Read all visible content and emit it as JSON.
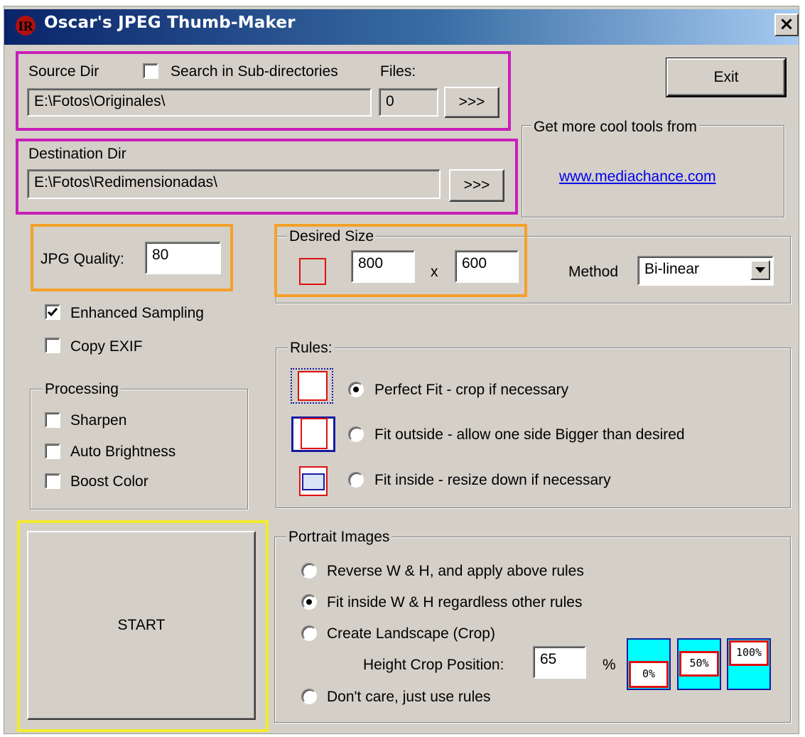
{
  "window": {
    "title": "Oscar's JPEG Thumb-Maker",
    "close_glyph": "×",
    "icon_text": "IR"
  },
  "source": {
    "label": "Source Dir",
    "search_sub_label": "Search in Sub-directories",
    "search_sub_checked": false,
    "files_label": "Files:",
    "path": "E:\\Fotos\\Originales\\",
    "files_count": "0",
    "browse_label": ">>>"
  },
  "destination": {
    "label": "Destination Dir",
    "path": "E:\\Fotos\\Redimensionadas\\",
    "browse_label": ">>>"
  },
  "exit_label": "Exit",
  "promo": {
    "legend": "Get more cool tools from",
    "link": "www.mediachance.com"
  },
  "quality": {
    "label": "JPG Quality:",
    "value": "80"
  },
  "size": {
    "legend": "Desired Size",
    "width": "800",
    "times": "x",
    "height": "600",
    "method_label": "Method",
    "method_value": "Bi-linear"
  },
  "options": {
    "enhanced_sampling": {
      "label": "Enhanced Sampling",
      "checked": true
    },
    "copy_exif": {
      "label": "Copy EXIF",
      "checked": false
    }
  },
  "processing": {
    "legend": "Processing",
    "sharpen": "Sharpen",
    "auto_brightness": "Auto Brightness",
    "boost_color": "Boost Color"
  },
  "rules": {
    "legend": "Rules:",
    "perfect_fit": "Perfect Fit - crop if necessary",
    "fit_outside": "Fit outside - allow one side Bigger than desired",
    "fit_inside": "Fit inside - resize down if necessary",
    "selected": "perfect_fit"
  },
  "start_label": "START",
  "portrait": {
    "legend": "Portrait Images",
    "reverse": "Reverse W & H, and apply above rules",
    "fit_inside": "Fit inside W & H regardless other rules",
    "landscape": "Create Landscape (Crop)",
    "crop_label": "Height Crop Position:",
    "crop_value": "65",
    "percent": "%",
    "dont_care": "Don't care, just use rules",
    "selected": "fit_inside",
    "preset_0": "0%",
    "preset_50": "50%",
    "preset_100": "100%"
  },
  "colors": {
    "highlight_magenta": "#c81fb8",
    "highlight_orange": "#f5a02a",
    "highlight_yellow": "#f2eb2c",
    "preset_cyan": "#00ffff"
  }
}
